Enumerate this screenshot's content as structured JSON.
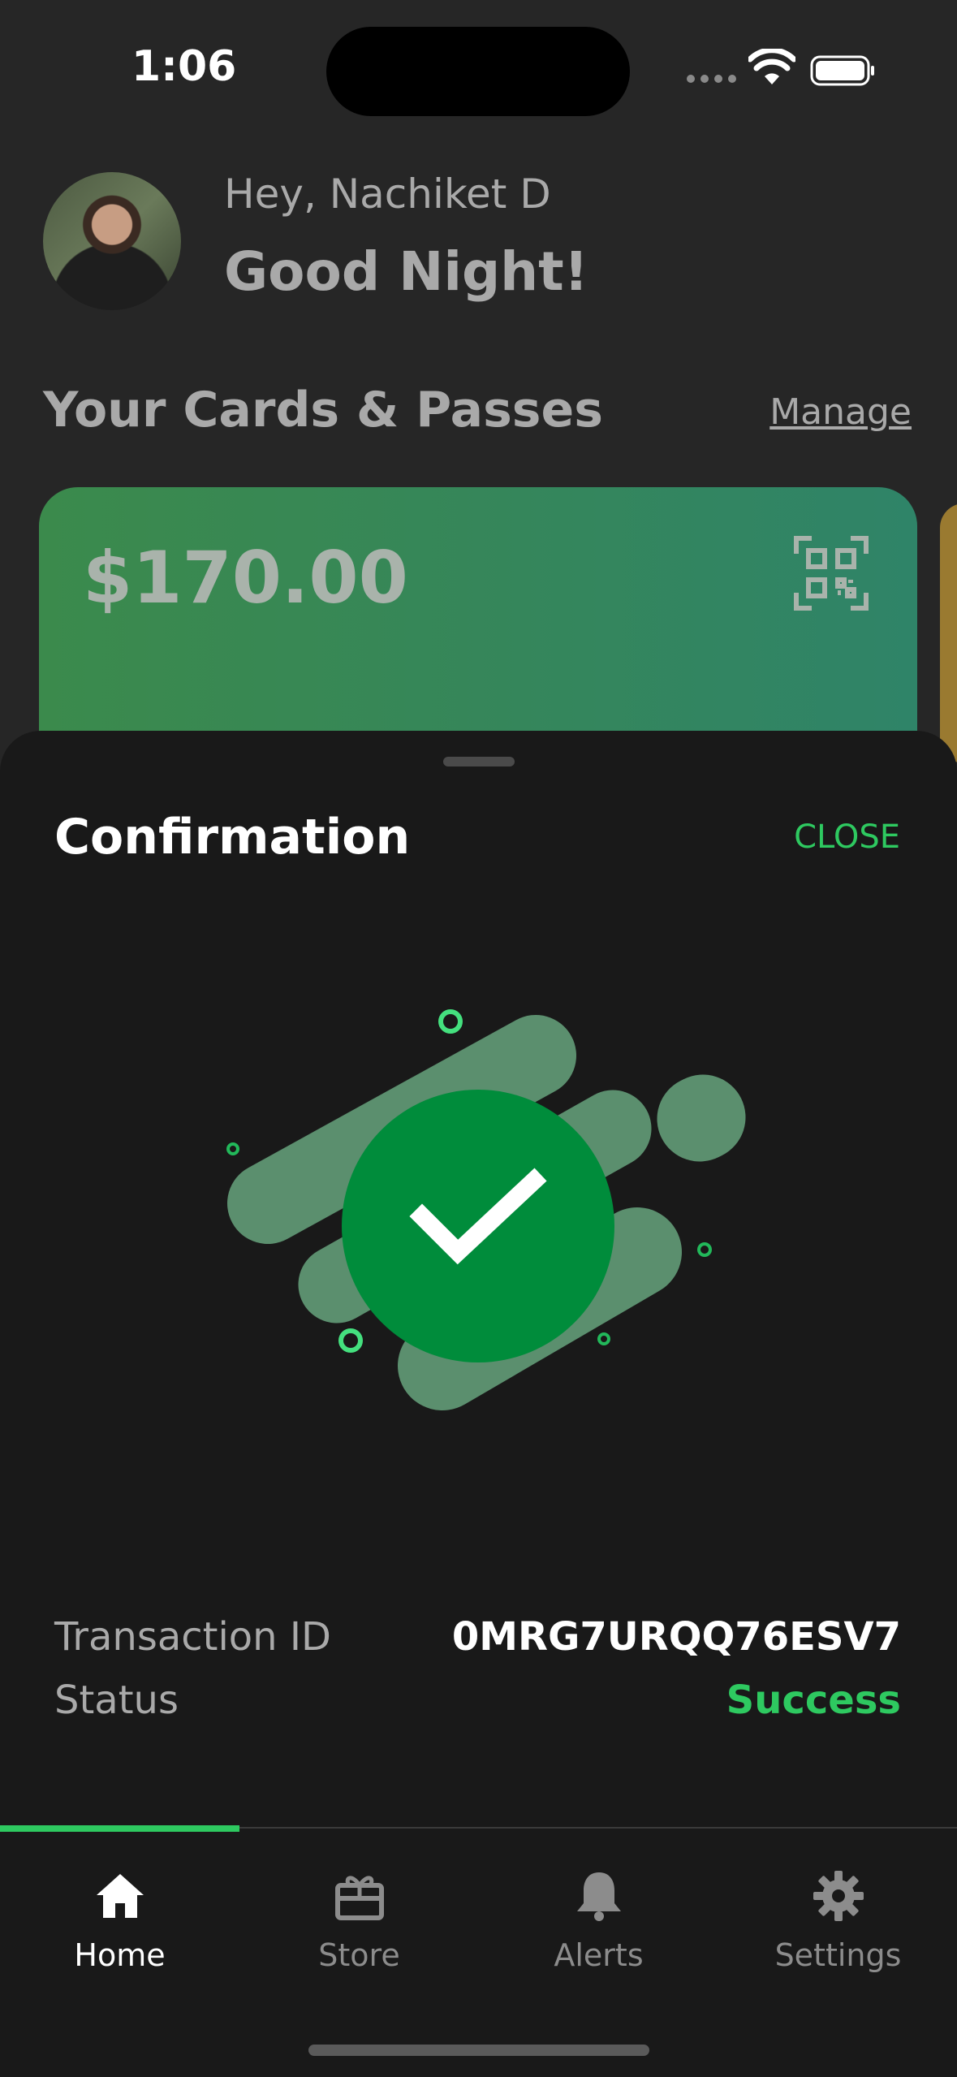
{
  "status_bar": {
    "time": "1:06"
  },
  "header": {
    "greeting": "Hey, Nachiket D",
    "salutation": "Good Night!",
    "avatar_icon": "user-avatar"
  },
  "cards_section": {
    "title": "Your Cards & Passes",
    "manage_label": "Manage",
    "card": {
      "amount": "$170.00",
      "icon": "qr-code-icon"
    }
  },
  "sheet": {
    "title": "Confirmation",
    "close_label": "CLOSE",
    "illustration_icon": "success-check-icon",
    "transaction_label": "Transaction ID",
    "transaction_id": "0MRG7URQQ76ESV7",
    "status_label": "Status",
    "status_value": "Success"
  },
  "tabs": [
    {
      "label": "Home",
      "icon": "home-icon",
      "active": true
    },
    {
      "label": "Store",
      "icon": "gift-icon",
      "active": false
    },
    {
      "label": "Alerts",
      "icon": "bell-icon",
      "active": false
    },
    {
      "label": "Settings",
      "icon": "gear-icon",
      "active": false
    }
  ],
  "colors": {
    "accent": "#2ec960",
    "card_green": "#358a5a",
    "sheet_bg": "#191919"
  }
}
